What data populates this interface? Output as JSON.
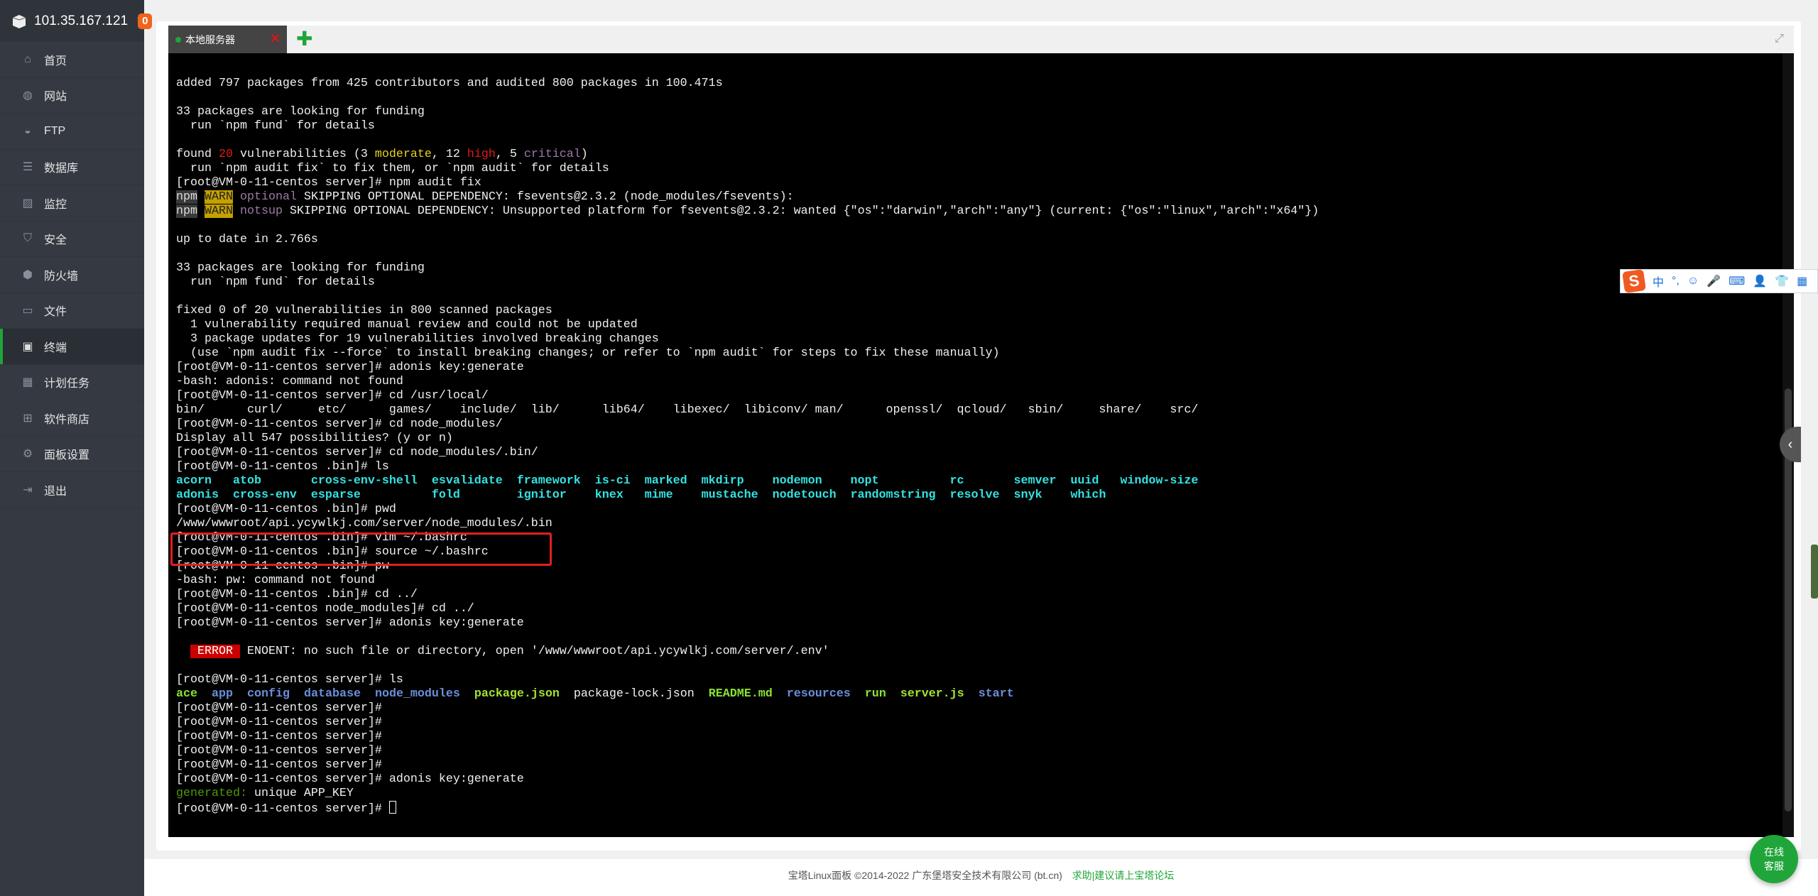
{
  "header": {
    "ip": "101.35.167.121",
    "badge_count": "0"
  },
  "sidebar": {
    "items": [
      {
        "label": "首页",
        "icon": "home-icon",
        "glyph": "⌂"
      },
      {
        "label": "网站",
        "icon": "globe-icon",
        "glyph": "◍"
      },
      {
        "label": "FTP",
        "icon": "ftp-icon",
        "glyph": "◒"
      },
      {
        "label": "数据库",
        "icon": "database-icon",
        "glyph": "☰"
      },
      {
        "label": "监控",
        "icon": "monitor-icon",
        "glyph": "▨"
      },
      {
        "label": "安全",
        "icon": "shield-icon",
        "glyph": "⛉"
      },
      {
        "label": "防火墙",
        "icon": "firewall-icon",
        "glyph": "⬢"
      },
      {
        "label": "文件",
        "icon": "folder-icon",
        "glyph": "▭"
      },
      {
        "label": "终端",
        "icon": "terminal-icon",
        "glyph": "▣",
        "active": true
      },
      {
        "label": "计划任务",
        "icon": "calendar-icon",
        "glyph": "▦"
      },
      {
        "label": "软件商店",
        "icon": "apps-icon",
        "glyph": "⊞"
      },
      {
        "label": "面板设置",
        "icon": "gear-icon",
        "glyph": "⚙"
      },
      {
        "label": "退出",
        "icon": "logout-icon",
        "glyph": "⇥"
      }
    ]
  },
  "tabs": {
    "active_label": "本地服务器",
    "close_glyph": "✕",
    "add_glyph": "✚",
    "expand_glyph": "⤢"
  },
  "colors": {
    "accent": "#20a53a",
    "red": "#e01b1b",
    "yellow": "#e8d21d",
    "purple": "#9d7aa6",
    "cyan": "#34e2e2",
    "blue": "#6a8fdc",
    "green": "#8ae234",
    "lime": "#a6e22e",
    "dkgreen": "#4e9a06",
    "warnbg": "#c4a000",
    "npmbg": "#3a3a3a",
    "errbg": "#cc0000"
  },
  "terminal": {
    "lines": [
      [
        {
          "t": "added 797 packages from 425 contributors and audited 800 packages in 100.471s"
        }
      ],
      [],
      [
        {
          "t": "33 packages are looking for funding"
        }
      ],
      [
        {
          "t": "  run `npm fund` for details"
        }
      ],
      [],
      [
        {
          "t": "found "
        },
        {
          "t": "20",
          "c": "red"
        },
        {
          "t": " vulnerabilities (3 "
        },
        {
          "t": "moderate",
          "c": "yellow"
        },
        {
          "t": ", 12 "
        },
        {
          "t": "high",
          "c": "red"
        },
        {
          "t": ", 5 "
        },
        {
          "t": "critical",
          "c": "purple"
        },
        {
          "t": ")"
        }
      ],
      [
        {
          "t": "  run `npm audit fix` to fix them, or `npm audit` for details"
        }
      ],
      [
        {
          "t": "[root@VM-0-11-centos server]# npm audit fix"
        }
      ],
      [
        {
          "t": "npm",
          "c": "npm"
        },
        {
          "t": " "
        },
        {
          "t": "WARN",
          "c": "warn"
        },
        {
          "t": " "
        },
        {
          "t": "optional",
          "c": "purple"
        },
        {
          "t": " SKIPPING OPTIONAL DEPENDENCY: fsevents@2.3.2 (node_modules/fsevents):"
        }
      ],
      [
        {
          "t": "npm",
          "c": "npm"
        },
        {
          "t": " "
        },
        {
          "t": "WARN",
          "c": "warn"
        },
        {
          "t": " "
        },
        {
          "t": "notsup",
          "c": "purple"
        },
        {
          "t": " SKIPPING OPTIONAL DEPENDENCY: Unsupported platform for fsevents@2.3.2: wanted {\"os\":\"darwin\",\"arch\":\"any\"} (current: {\"os\":\"linux\",\"arch\":\"x64\"})"
        }
      ],
      [],
      [
        {
          "t": "up to date in 2.766s"
        }
      ],
      [],
      [
        {
          "t": "33 packages are looking for funding"
        }
      ],
      [
        {
          "t": "  run `npm fund` for details"
        }
      ],
      [],
      [
        {
          "t": "fixed 0 of 20 vulnerabilities in 800 scanned packages"
        }
      ],
      [
        {
          "t": "  1 vulnerability required manual review and could not be updated"
        }
      ],
      [
        {
          "t": "  3 package updates for 19 vulnerabilities involved breaking changes"
        }
      ],
      [
        {
          "t": "  (use `npm audit fix --force` to install breaking changes; or refer to `npm audit` for steps to fix these manually)"
        }
      ],
      [
        {
          "t": "[root@VM-0-11-centos server]# adonis key:generate"
        }
      ],
      [
        {
          "t": "-bash: adonis: command not found"
        }
      ],
      [
        {
          "t": "[root@VM-0-11-centos server]# cd /usr/local/"
        }
      ],
      [
        {
          "t": "bin/      curl/     etc/      games/    include/  lib/      lib64/    libexec/  libiconv/ man/      openssl/  qcloud/   sbin/     share/    src/"
        }
      ],
      [
        {
          "t": "[root@VM-0-11-centos server]# cd node_modules/"
        }
      ],
      [
        {
          "t": "Display all 547 possibilities? (y or n)"
        }
      ],
      [
        {
          "t": "[root@VM-0-11-centos server]# cd node_modules/.bin/"
        }
      ],
      [
        {
          "t": "[root@VM-0-11-centos .bin]# ls"
        }
      ],
      [
        {
          "t": "acorn   atob       cross-env-shell  esvalidate  framework  is-ci  marked  mkdirp    nodemon    nopt          rc       semver  uuid   window-size",
          "c": "cyan"
        }
      ],
      [
        {
          "t": "adonis  cross-env  esparse          fold        ignitor    knex   mime    mustache  nodetouch  randomstring  resolve  snyk    which",
          "c": "cyan"
        }
      ],
      [
        {
          "t": "[root@VM-0-11-centos .bin]# pwd"
        }
      ],
      [
        {
          "t": "/www/wwwroot/api.ycywlkj.com/server/node_modules/.bin"
        }
      ],
      [
        {
          "t": "[root@VM-0-11-centos .bin]# vim ~/.bashrc"
        }
      ],
      [
        {
          "t": "[root@VM-0-11-centos .bin]# source ~/.bashrc"
        }
      ],
      [
        {
          "t": "[root@VM-0-11-centos .bin]# pw"
        }
      ],
      [
        {
          "t": "-bash: pw: command not found"
        }
      ],
      [
        {
          "t": "[root@VM-0-11-centos .bin]# cd ../"
        }
      ],
      [
        {
          "t": "[root@VM-0-11-centos node_modules]# cd ../"
        }
      ],
      [
        {
          "t": "[root@VM-0-11-centos server]# adonis key:generate"
        }
      ],
      [],
      [
        {
          "t": "  "
        },
        {
          "t": " ERROR ",
          "c": "err"
        },
        {
          "t": " ENOENT: no such file or directory, open '/www/wwwroot/api.ycywlkj.com/server/.env'"
        }
      ],
      [],
      [
        {
          "t": "[root@VM-0-11-centos server]# ls"
        }
      ],
      [
        {
          "t": "ace",
          "c": "green"
        },
        {
          "t": "  "
        },
        {
          "t": "app",
          "c": "blue"
        },
        {
          "t": "  "
        },
        {
          "t": "config",
          "c": "blue"
        },
        {
          "t": "  "
        },
        {
          "t": "database",
          "c": "blue"
        },
        {
          "t": "  "
        },
        {
          "t": "node_modules",
          "c": "blue"
        },
        {
          "t": "  "
        },
        {
          "t": "package.json",
          "c": "lime"
        },
        {
          "t": "  package-lock.json  "
        },
        {
          "t": "README.md",
          "c": "green"
        },
        {
          "t": "  "
        },
        {
          "t": "resources",
          "c": "blue"
        },
        {
          "t": "  "
        },
        {
          "t": "run",
          "c": "green"
        },
        {
          "t": "  "
        },
        {
          "t": "server.js",
          "c": "lime"
        },
        {
          "t": "  "
        },
        {
          "t": "start",
          "c": "blue"
        }
      ],
      [
        {
          "t": "[root@VM-0-11-centos server]#"
        }
      ],
      [
        {
          "t": "[root@VM-0-11-centos server]#"
        }
      ],
      [
        {
          "t": "[root@VM-0-11-centos server]#"
        }
      ],
      [
        {
          "t": "[root@VM-0-11-centos server]#"
        }
      ],
      [
        {
          "t": "[root@VM-0-11-centos server]#"
        }
      ],
      [
        {
          "t": "[root@VM-0-11-centos server]# adonis key:generate"
        }
      ],
      [
        {
          "t": "generated:",
          "c": "dkgreen"
        },
        {
          "t": " unique APP_KEY"
        }
      ],
      [
        {
          "t": "[root@VM-0-11-centos server]# "
        },
        {
          "t": "",
          "c": "cursor"
        }
      ]
    ]
  },
  "ime": {
    "logo": "S",
    "items": [
      "中",
      "°,",
      "☺",
      "🎤",
      "⌨",
      "👤",
      "👕",
      "▦"
    ]
  },
  "side_toggle": "‹",
  "footer": {
    "copyright": "宝塔Linux面板 ©2014-2022 广东堡塔安全技术有限公司 (bt.cn)",
    "link": "求助|建议请上宝塔论坛"
  },
  "help_button": {
    "line1": "在线",
    "line2": "客服"
  }
}
